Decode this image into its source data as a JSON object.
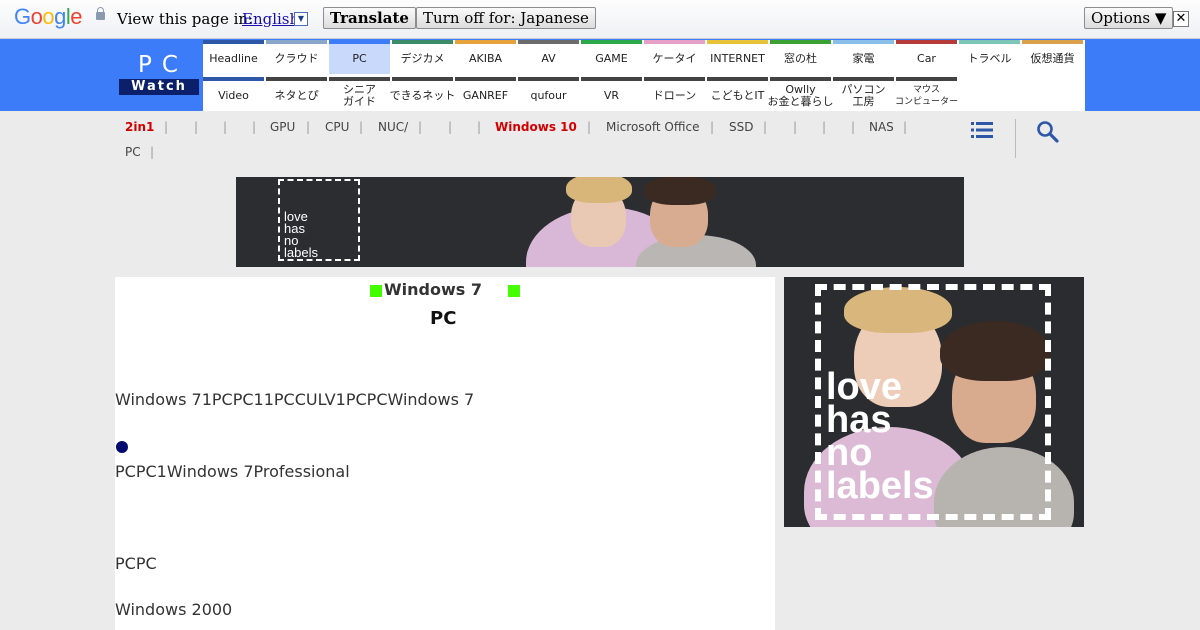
{
  "translate_bar": {
    "logo_text": "Google",
    "prompt": "View this page in:",
    "language": "English",
    "translate_button": "Translate",
    "turn_off_button": "Turn off for: Japanese",
    "options_button": "Options ▼",
    "close_glyph": "✕"
  },
  "logo": {
    "top": "PC",
    "bottom": "Watch"
  },
  "nav": {
    "row1": [
      {
        "label": "Headline",
        "color": "#2f57a8"
      },
      {
        "label": "クラウド",
        "color": "#8aa6c9"
      },
      {
        "label": "PC",
        "color": "#3d7cf9",
        "selected": true
      },
      {
        "label": "デジカメ",
        "color": "#3c8c6a"
      },
      {
        "label": "AKIBA",
        "color": "#e8a23b"
      },
      {
        "label": "AV",
        "color": "#6c6c6c"
      },
      {
        "label": "GAME",
        "color": "#2aa84a"
      },
      {
        "label": "ケータイ",
        "color": "#e5a0c8"
      },
      {
        "label": "INTERNET",
        "color": "#e7c33a"
      },
      {
        "label": "窓の杜",
        "color": "#3aa132"
      },
      {
        "label": "家電",
        "color": "#89bfe8"
      },
      {
        "label": "Car",
        "color": "#b53a3a"
      },
      {
        "label": "トラベル",
        "color": "#7dc6b8"
      },
      {
        "label": "仮想通貨",
        "color": "#d9a24a"
      }
    ],
    "row2": [
      {
        "label": "Video",
        "color": "#2f57a8"
      },
      {
        "label": "ネタとぴ",
        "color": "#444444"
      },
      {
        "label": "シニア\nガイド",
        "color": "#444444"
      },
      {
        "label": "できるネット",
        "color": "#444444"
      },
      {
        "label": "GANREF",
        "color": "#444444"
      },
      {
        "label": "qufour",
        "color": "#444444"
      },
      {
        "label": "VR",
        "color": "#444444"
      },
      {
        "label": "ドローン",
        "color": "#444444"
      },
      {
        "label": "こどもとIT",
        "color": "#444444"
      },
      {
        "label": "Owlly\nお金と暮らし",
        "color": "#444444"
      },
      {
        "label": "パソコン\n工房",
        "color": "#444444"
      },
      {
        "label": "マウス\nコンピューター",
        "color": "#444444",
        "small": true
      }
    ]
  },
  "subnav": {
    "item_2in1": "2in1",
    "gpu": "GPU",
    "cpu": "CPU",
    "nuc": "NUC/",
    "win10": "Windows 10",
    "office": "Microsoft Office",
    "ssd": "SSD",
    "nas": "NAS",
    "pc": "PC",
    "sep": "|"
  },
  "banner": {
    "text": "love\nhas\nno\nlabels"
  },
  "side_ad": {
    "text": "love\nhas\nno\nlabels"
  },
  "article": {
    "title": "Windows 7",
    "subtitle": "PC",
    "para1": "Windows 71PCPC11PCCULV1PCPCWindows 7",
    "para2": "PCPC1Windows 7Professional",
    "para3": "PCPC",
    "para4": "Windows 2000"
  },
  "colors": {
    "header_blue": "#3d7cf9",
    "accent_red": "#d40000",
    "square_green": "#44ff00"
  }
}
